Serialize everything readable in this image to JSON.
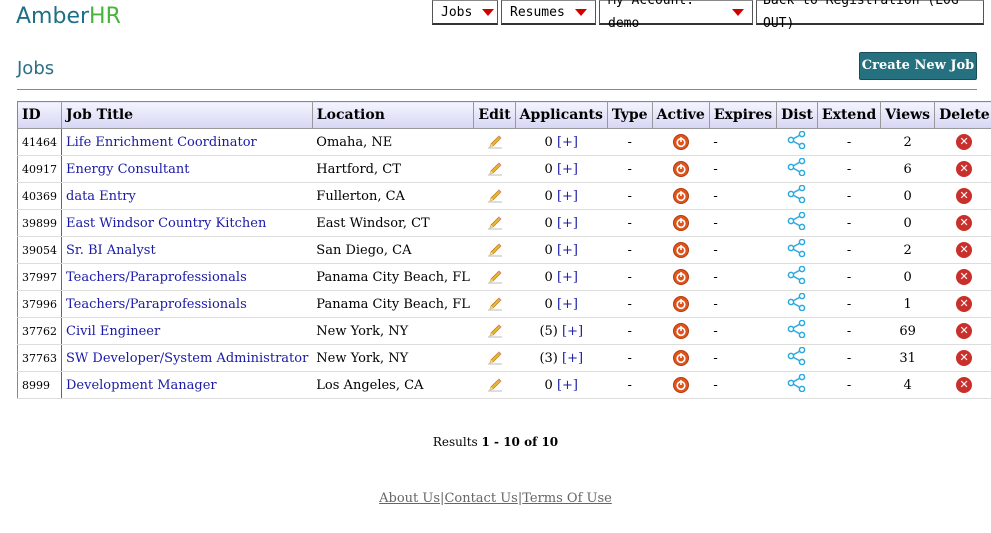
{
  "logo": {
    "part1": "Amber",
    "part2": "HR"
  },
  "nav": {
    "jobs": "Jobs",
    "resumes": "Resumes",
    "account": "My Account: demo",
    "back": "Back to Registration (LOG OUT)"
  },
  "page": {
    "title": "Jobs",
    "create_button": "Create New Job"
  },
  "table": {
    "headers": {
      "id": "ID",
      "job_title": "Job Title",
      "location": "Location",
      "edit": "Edit",
      "applicants": "Applicants",
      "type": "Type",
      "active": "Active",
      "expires": "Expires",
      "dist": "Dist",
      "extend": "Extend",
      "views": "Views",
      "delete": "Delete"
    },
    "rows": [
      {
        "id": "41464",
        "title": "Life Enrichment Coordinator",
        "location": "Omaha, NE",
        "applicants": "0",
        "add": "[+]",
        "type": "-",
        "expires": "-",
        "extend": "-",
        "views": "2"
      },
      {
        "id": "40917",
        "title": "Energy Consultant",
        "location": "Hartford, CT",
        "applicants": "0",
        "add": "[+]",
        "type": "-",
        "expires": "-",
        "extend": "-",
        "views": "6"
      },
      {
        "id": "40369",
        "title": "data Entry",
        "location": "Fullerton, CA",
        "applicants": "0",
        "add": "[+]",
        "type": "-",
        "expires": "-",
        "extend": "-",
        "views": "0"
      },
      {
        "id": "39899",
        "title": "East Windsor Country Kitchen",
        "location": "East Windsor, CT",
        "applicants": "0",
        "add": "[+]",
        "type": "-",
        "expires": "-",
        "extend": "-",
        "views": "0"
      },
      {
        "id": "39054",
        "title": "Sr. BI Analyst",
        "location": "San Diego, CA",
        "applicants": "0",
        "add": "[+]",
        "type": "-",
        "expires": "-",
        "extend": "-",
        "views": "2"
      },
      {
        "id": "37997",
        "title": "Teachers/Paraprofessionals",
        "location": "Panama City Beach, FL",
        "applicants": "0",
        "add": "[+]",
        "type": "-",
        "expires": "-",
        "extend": "-",
        "views": "0"
      },
      {
        "id": "37996",
        "title": "Teachers/Paraprofessionals",
        "location": "Panama City Beach, FL",
        "applicants": "0",
        "add": "[+]",
        "type": "-",
        "expires": "-",
        "extend": "-",
        "views": "1"
      },
      {
        "id": "37762",
        "title": "Civil Engineer",
        "location": "New York, NY",
        "applicants": "(5)",
        "add": "[+]",
        "type": "-",
        "expires": "-",
        "extend": "-",
        "views": "69"
      },
      {
        "id": "37763",
        "title": "SW Developer/System Administrator",
        "location": "New York, NY",
        "applicants": "(3)",
        "add": "[+]",
        "type": "-",
        "expires": "-",
        "extend": "-",
        "views": "31"
      },
      {
        "id": "8999",
        "title": "Development Manager",
        "location": "Los Angeles, CA",
        "applicants": "0",
        "add": "[+]",
        "type": "-",
        "expires": "-",
        "extend": "-",
        "views": "4"
      }
    ]
  },
  "results": {
    "prefix": "Results ",
    "range": "1 - 10",
    "of": " of ",
    "total": "10"
  },
  "footer": {
    "about": "About Us",
    "sep": "|",
    "contact": "Contact Us",
    "terms": "Terms Of Use"
  },
  "icons": {
    "edit": "pencil-icon",
    "active": "power-icon",
    "dist": "share-icon",
    "delete": "delete-icon"
  },
  "colors": {
    "brand": "#1f6f86",
    "brand_accent": "#49b43a",
    "create_button": "#25717f",
    "link": "#1a1aa6",
    "nav_arrow": "#d10000"
  }
}
